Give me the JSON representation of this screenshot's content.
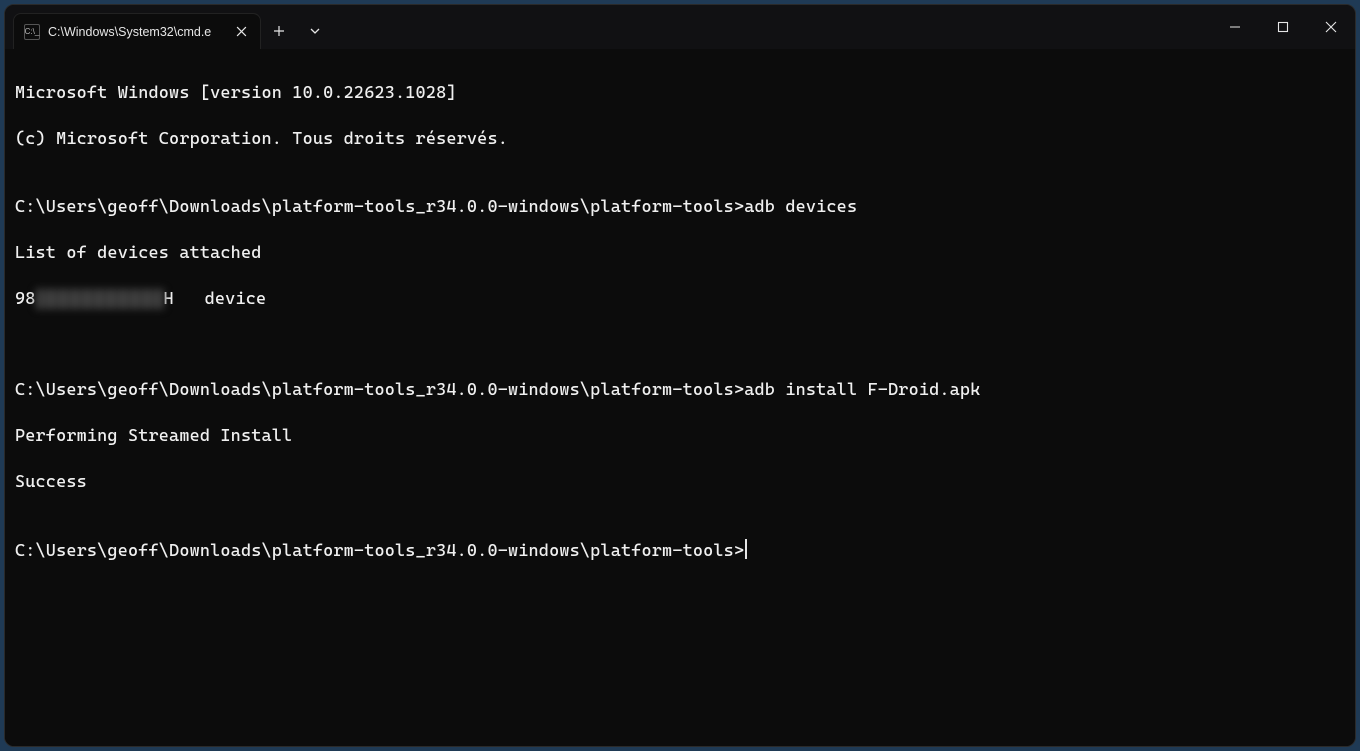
{
  "tab": {
    "title": "C:\\Windows\\System32\\cmd.e",
    "icon_label": "C:\\_"
  },
  "terminal": {
    "lines": {
      "l1": "Microsoft Windows [version 10.0.22623.1028]",
      "l2": "(c) Microsoft Corporation. Tous droits réservés.",
      "l3": "",
      "l4_prompt": "C:\\Users\\geoff\\Downloads\\platform-tools_r34.0.0-windows\\platform-tools>",
      "l4_cmd": "adb devices",
      "l5": "List of devices attached",
      "l6_prefix": "98",
      "l6_suffix": "H   device",
      "l7": "",
      "l8": "",
      "l9_prompt": "C:\\Users\\geoff\\Downloads\\platform-tools_r34.0.0-windows\\platform-tools>",
      "l9_cmd": "adb install F-Droid.apk",
      "l10": "Performing Streamed Install",
      "l11": "Success",
      "l12": "",
      "l13_prompt": "C:\\Users\\geoff\\Downloads\\platform-tools_r34.0.0-windows\\platform-tools>"
    }
  }
}
